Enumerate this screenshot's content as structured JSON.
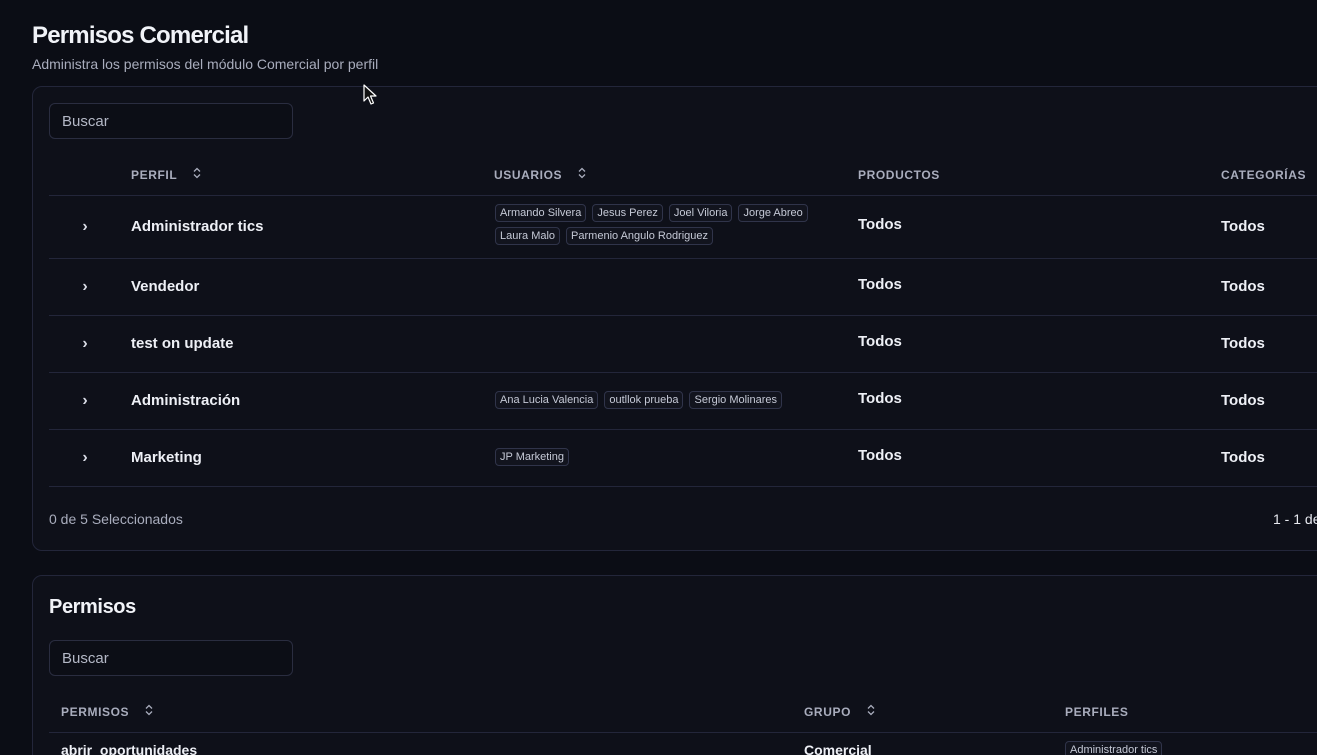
{
  "header": {
    "title": "Permisos Comercial",
    "subtitle": "Administra los permisos del módulo Comercial por perfil"
  },
  "profiles_table": {
    "search_placeholder": "Buscar",
    "columns": [
      "PERFIL",
      "USUARIOS",
      "PRODUCTOS",
      "CATEGORÍAS"
    ],
    "rows": [
      {
        "perfil": "Administrador tics",
        "usuarios": [
          "Armando Silvera",
          "Jesus Perez",
          "Joel Viloria",
          "Jorge Abreo",
          "Laura Malo",
          "Parmenio Angulo Rodriguez"
        ],
        "productos": "Todos",
        "categorias": "Todos"
      },
      {
        "perfil": "Vendedor",
        "usuarios": [],
        "productos": "Todos",
        "categorias": "Todos"
      },
      {
        "perfil": "test on update",
        "usuarios": [],
        "productos": "Todos",
        "categorias": "Todos"
      },
      {
        "perfil": "Administración",
        "usuarios": [
          "Ana Lucia Valencia",
          "outllok prueba",
          "Sergio Molinares"
        ],
        "productos": "Todos",
        "categorias": "Todos"
      },
      {
        "perfil": "Marketing",
        "usuarios": [
          "JP Marketing"
        ],
        "productos": "Todos",
        "categorias": "Todos"
      }
    ],
    "selection_text": "0 de 5 Seleccionados",
    "pagination_text": "1 - 1 de"
  },
  "permisos_section": {
    "title": "Permisos",
    "search_placeholder": "Buscar",
    "columns": [
      "PERMISOS",
      "GRUPO",
      "PERFILES"
    ],
    "rows": [
      {
        "permiso": "abrir_oportunidades",
        "grupo": "Comercial",
        "perfiles": [
          "Administrador tics"
        ]
      }
    ]
  },
  "icons": {
    "sort": "sort-icon",
    "expand": "chevron-right-icon",
    "cursor": "mouse-pointer-icon"
  },
  "colors": {
    "background": "#0b0d15",
    "card": "#0e1019",
    "border": "#23263a",
    "muted_text": "#a9adbd"
  }
}
